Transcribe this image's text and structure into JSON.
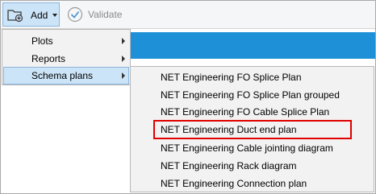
{
  "toolbar": {
    "add_label": "Add",
    "add_icon": "folder-add-icon",
    "validate_label": "Validate",
    "validate_icon": "check-circle-icon"
  },
  "add_menu": {
    "items": [
      {
        "label": "Plots",
        "has_submenu": true
      },
      {
        "label": "Reports",
        "has_submenu": true
      },
      {
        "label": "Schema plans",
        "has_submenu": true,
        "selected": true
      }
    ]
  },
  "schema_plans_menu": {
    "items": [
      {
        "label": "NET Engineering FO Splice Plan"
      },
      {
        "label": "NET Engineering FO Splice Plan grouped"
      },
      {
        "label": "NET Engineering FO Cable Splice Plan"
      },
      {
        "label": "NET Engineering Duct end plan",
        "highlighted": true
      },
      {
        "label": "NET Engineering Cable jointing diagram"
      },
      {
        "label": "NET Engineering Rack diagram"
      },
      {
        "label": "NET Engineering Connection plan"
      }
    ]
  },
  "colors": {
    "accent_band": "#1e90d8",
    "selection": "#cce4f7",
    "highlight_box": "#e00000"
  }
}
